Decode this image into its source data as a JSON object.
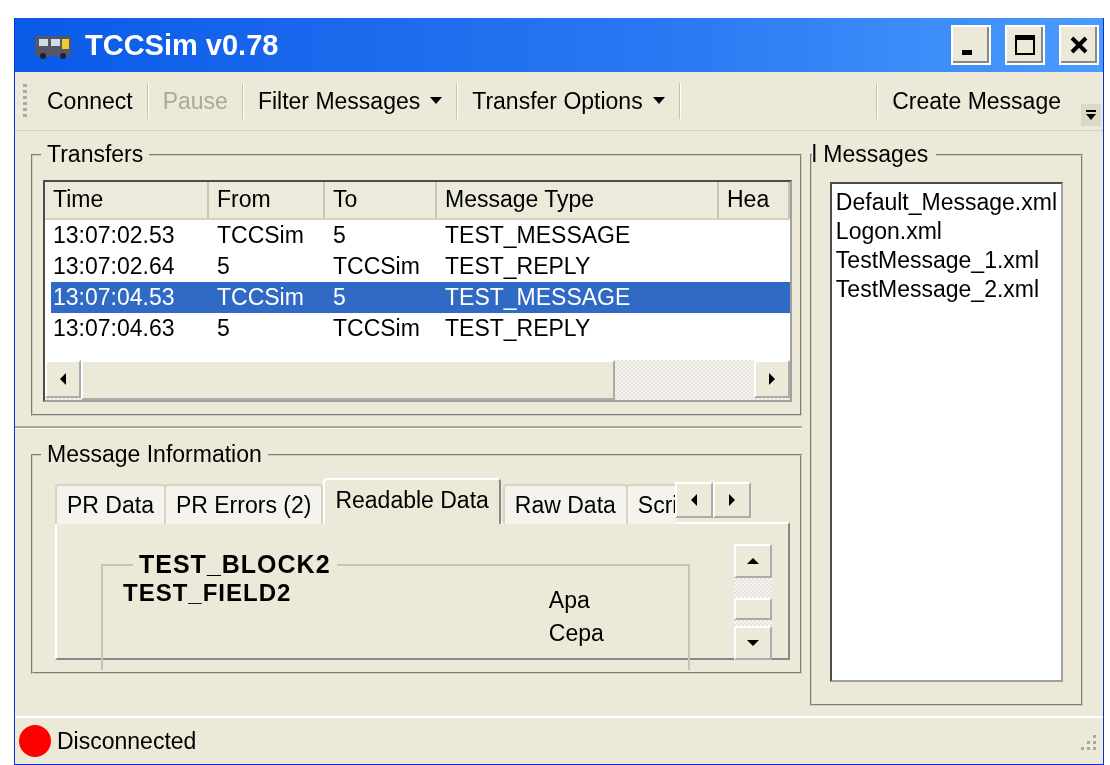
{
  "window": {
    "title": "TCCSim v0.78"
  },
  "toolbar": {
    "left": [
      {
        "label": "Connect",
        "kind": "button",
        "disabled": false
      },
      {
        "label": "Pause",
        "kind": "button",
        "disabled": true
      },
      {
        "label": "Filter Messages",
        "kind": "dropdown",
        "disabled": false
      },
      {
        "label": "Transfer Options",
        "kind": "dropdown",
        "disabled": false
      }
    ],
    "right": [
      {
        "label": "Create Message",
        "kind": "button",
        "disabled": false
      }
    ]
  },
  "transfers": {
    "title": "Transfers",
    "columns": [
      "Time",
      "From",
      "To",
      "Message Type",
      "Hea"
    ],
    "rows": [
      {
        "cells": [
          "13:07:02.53",
          "TCCSim",
          "5",
          "TEST_MESSAGE"
        ],
        "selected": false
      },
      {
        "cells": [
          "13:07:02.64",
          "5",
          "TCCSim",
          "TEST_REPLY"
        ],
        "selected": false
      },
      {
        "cells": [
          "13:07:04.53",
          "TCCSim",
          "5",
          "TEST_MESSAGE"
        ],
        "selected": true
      },
      {
        "cells": [
          "13:07:04.63",
          "5",
          "TCCSim",
          "TEST_REPLY"
        ],
        "selected": false
      }
    ]
  },
  "message_info": {
    "title": "Message Information",
    "tabs": [
      {
        "label": "PR Data",
        "selected": false
      },
      {
        "label": "PR Errors (2)",
        "selected": false
      },
      {
        "label": "Readable Data",
        "selected": true
      },
      {
        "label": "Raw Data",
        "selected": false
      },
      {
        "label": "Scri",
        "selected": false
      }
    ],
    "block": {
      "title": "TEST_BLOCK2",
      "field": "TEST_FIELD2",
      "values": [
        "Apa",
        "Cepa"
      ]
    }
  },
  "messages_panel": {
    "title": "l Messages",
    "files": [
      "Default_Message.xml",
      "Logon.xml",
      "TestMessage_1.xml",
      "TestMessage_2.xml"
    ]
  },
  "status_bar": {
    "text": "Disconnected",
    "connected": false
  }
}
